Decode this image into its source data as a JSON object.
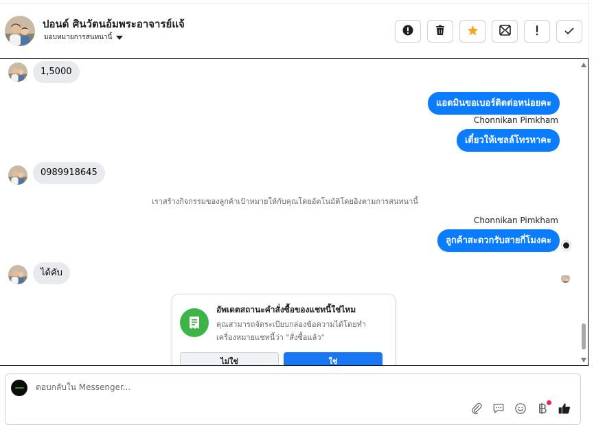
{
  "header": {
    "contact_name": "ปอนด์ ศินวัตนอ้มพระอาจารย์แจ้",
    "assign_label": "มอบหมายการสนทนานี้"
  },
  "toolbar": {
    "buttons": [
      "report-spam-icon",
      "delete-icon",
      "star-icon",
      "mark-unread-icon",
      "follow-up-icon",
      "mark-done-icon"
    ],
    "star_color": "#f5a623"
  },
  "messages": [
    {
      "type": "in",
      "text": "1,5000"
    },
    {
      "type": "out",
      "text": "แอดมินขอเบอร์ติดต่อหน่อยคะ"
    },
    {
      "type": "sender",
      "text": "Chonnikan Pimkham"
    },
    {
      "type": "out",
      "text": "เดี๋ยวให้เซลล์โทรหาคะ"
    },
    {
      "type": "in",
      "text": "0989918645"
    },
    {
      "type": "system",
      "text": "เราสร้างกิจกรรมของลูกค้าเป้าหมายให้กับคุณโดยอัตโนมัติโดยอิงตามการสนทนานี้"
    },
    {
      "type": "sender",
      "text": "Chonnikan Pimkham"
    },
    {
      "type": "out",
      "text": "ลูกค้าสะดวกรับสายกี่โมงคะ"
    },
    {
      "type": "in",
      "text": "ได้คับ"
    }
  ],
  "prompt_card": {
    "title": "อัพเดตสถานะคำสั่งซื้อของแชทนี้ใช่ไหม",
    "body": "คุณสามารถจัดระเบียบกล่องข้อความได้โดยทำเครื่องหมายแชทนี้ว่า \"สั่งซื้อแล้ว\"",
    "no_label": "ไม่ใช่",
    "yes_label": "ใช่"
  },
  "composer": {
    "placeholder": "ตอบกลับใน Messenger...",
    "tools": [
      "attach-icon",
      "saved-replies-icon",
      "emoji-icon",
      "baht-payment-icon",
      "like-icon"
    ]
  },
  "colors": {
    "outgoing_bubble": "#0a7cff",
    "incoming_bubble": "#e9eaee",
    "primary_button": "#1877f2",
    "card_icon": "#3cb447"
  }
}
